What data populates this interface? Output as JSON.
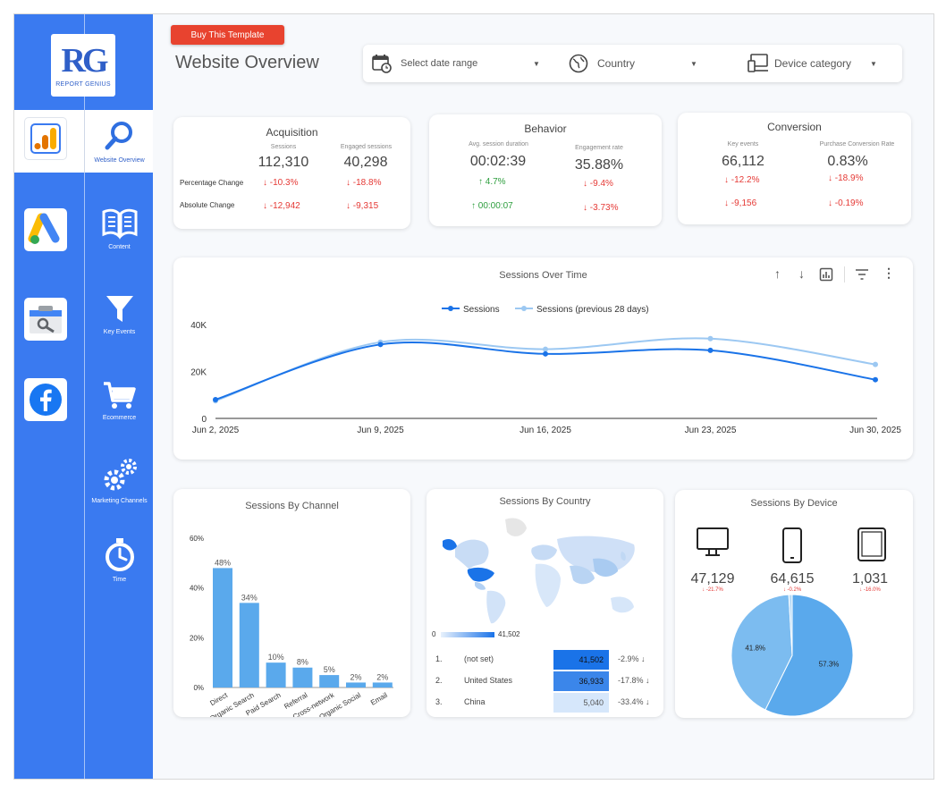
{
  "brand": {
    "logo_letters": "RG",
    "logo_tagline": "REPORT GENIUS"
  },
  "buy_button": "Buy This Template",
  "page_title": "Website Overview",
  "filters": {
    "date": "Select date range",
    "country": "Country",
    "device": "Device category"
  },
  "nav": [
    {
      "label": "Website Overview",
      "icon": "search-icon"
    },
    {
      "label": "Content",
      "icon": "book-icon"
    },
    {
      "label": "Key Events",
      "icon": "funnel-icon"
    },
    {
      "label": "Ecommerce",
      "icon": "cart-icon"
    },
    {
      "label": "Marketing Channels",
      "icon": "gears-icon"
    },
    {
      "label": "Time",
      "icon": "stopwatch-icon"
    }
  ],
  "side_tiles": [
    "google-analytics-icon",
    "google-ads-icon",
    "search-console-icon",
    "facebook-icon"
  ],
  "kpi": {
    "acquisition": {
      "title": "Acquisition",
      "row_labels": {
        "pct": "Percentage Change",
        "abs": "Absolute Change"
      },
      "metrics": [
        {
          "label": "Sessions",
          "value": "112,310",
          "pct": "-10.3%",
          "abs": "-12,942"
        },
        {
          "label": "Engaged sessions",
          "value": "40,298",
          "pct": "-18.8%",
          "abs": "-9,315"
        }
      ]
    },
    "behavior": {
      "title": "Behavior",
      "metrics": [
        {
          "label": "Avg. session duration",
          "value": "00:02:39",
          "pct": "4.7%",
          "abs": "00:00:07"
        },
        {
          "label": "Engagement rate",
          "value": "35.88%",
          "pct": "-9.4%",
          "abs": "-3.73%"
        }
      ]
    },
    "conversion": {
      "title": "Conversion",
      "metrics": [
        {
          "label": "Key events",
          "value": "66,112",
          "pct": "-12.2%",
          "abs": "-9,156"
        },
        {
          "label": "Purchase Conversion Rate",
          "value": "0.83%",
          "pct": "-18.9%",
          "abs": "-0.19%"
        }
      ]
    }
  },
  "chart_data": [
    {
      "type": "line",
      "title": "Sessions Over Time",
      "x": [
        "Jun 2, 2025",
        "Jun 9, 2025",
        "Jun 16, 2025",
        "Jun 23, 2025",
        "Jun 30, 2025"
      ],
      "series": [
        {
          "name": "Sessions",
          "values": [
            8000,
            31500,
            27500,
            29000,
            16500
          ],
          "color": "#1a73e8"
        },
        {
          "name": "Sessions (previous 28 days)",
          "values": [
            7500,
            32500,
            29500,
            34000,
            23000
          ],
          "color": "#9cc8f2"
        }
      ],
      "ylim": [
        0,
        40000
      ],
      "yticks": [
        "0",
        "20K",
        "40K"
      ],
      "legend": "top"
    },
    {
      "type": "bar",
      "title": "Sessions By Channel",
      "categories": [
        "Direct",
        "Organic Search",
        "Paid Search",
        "Referral",
        "Cross-network",
        "Organic Social",
        "Email"
      ],
      "values": [
        48,
        34,
        10,
        8,
        5,
        2,
        2
      ],
      "labels": [
        "48%",
        "34%",
        "10%",
        "8%",
        "5%",
        "2%",
        "2%"
      ],
      "yticks": [
        "0%",
        "20%",
        "40%",
        "60%"
      ],
      "ylim": [
        0,
        60
      ]
    },
    {
      "type": "pie",
      "title": "Sessions By Device",
      "slices": [
        {
          "label": "57.3%",
          "value": 57.3,
          "color": "#5aa9ec"
        },
        {
          "label": "41.8%",
          "value": 41.8,
          "color": "#7cbcf0"
        },
        {
          "label": "",
          "value": 0.9,
          "color": "#b9dcf7"
        }
      ]
    }
  ],
  "country": {
    "title": "Sessions By Country",
    "scale_min": "0",
    "scale_max": "41,502",
    "rows": [
      {
        "rank": "1.",
        "name": "(not set)",
        "value": "41,502",
        "change": "-2.9%",
        "color": "#1a73e8"
      },
      {
        "rank": "2.",
        "name": "United States",
        "value": "36,933",
        "change": "-17.8%",
        "color": "#3b86ea"
      },
      {
        "rank": "3.",
        "name": "China",
        "value": "5,040",
        "change": "-33.4%",
        "color": "#d6e7fb"
      }
    ]
  },
  "devices": [
    {
      "icon": "desktop-icon",
      "value": "47,129",
      "change": "-21.7%"
    },
    {
      "icon": "mobile-icon",
      "value": "64,615",
      "change": "-0.2%"
    },
    {
      "icon": "tablet-icon",
      "value": "1,031",
      "change": "-16.0%"
    }
  ]
}
